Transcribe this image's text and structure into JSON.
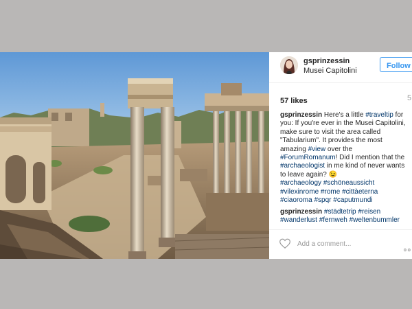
{
  "post": {
    "username": "gsprinzessin",
    "location": "Musei Capitolini",
    "follow_label": "Follow",
    "likes": "57 likes",
    "time_ago": "5",
    "caption": {
      "author": "gsprinzessin",
      "t1": " Here's a little ",
      "h_traveltip": "#traveltip",
      "t2": " for you: If you're ever in the Musei Capitolini, make sure to visit the area called \"Tabularium\". It provides the most amazing ",
      "h_view": "#view",
      "t3": " over the ",
      "h_forum": "#ForumRomanum",
      "t4": "! Did I mention that the ",
      "h_archaeologist": "#archaeologist",
      "t5": " in me kind of never wants to leave again? 😉",
      "tags": [
        "#archaeology",
        "#schöneaussicht",
        "#vilexinrome",
        "#rome",
        "#cittàeterna",
        "#ciaoroma",
        "#spqr",
        "#caputmundi"
      ]
    },
    "comment": {
      "author": "gsprinzessin",
      "tags": [
        "#städtetrip",
        "#reisen",
        "#wanderlust",
        "#fernweh",
        "#weltenbummler"
      ]
    },
    "comment_placeholder": "Add a comment...",
    "colors": {
      "link": "#003569",
      "follow": "#3897f0",
      "background": "#b9b7b6"
    },
    "icons": {
      "like": "heart-icon",
      "more": "more-options-icon"
    }
  }
}
